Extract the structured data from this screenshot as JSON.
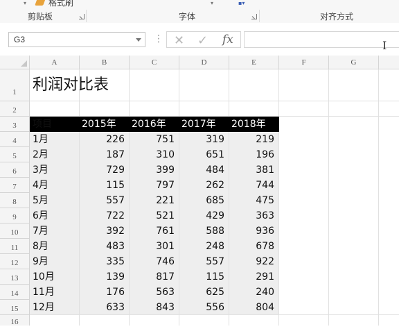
{
  "ribbon": {
    "format_painter": "格式刷",
    "groups": [
      "剪贴板",
      "字体",
      "对齐方式"
    ]
  },
  "formula_bar": {
    "name_box": "G3",
    "cancel_icon": "✕",
    "enter_icon": "✓",
    "fx_label": "fx",
    "formula": ""
  },
  "columns": [
    "A",
    "B",
    "C",
    "D",
    "E",
    "F",
    "G"
  ],
  "rows": [
    "1",
    "2",
    "3",
    "4",
    "5",
    "6",
    "7",
    "8",
    "9",
    "10",
    "11",
    "12",
    "13",
    "14",
    "15",
    "16"
  ],
  "sheet": {
    "title": "利润对比表",
    "headers": [
      "项目",
      "2015年",
      "2016年",
      "2017年",
      "2018年"
    ],
    "data": [
      [
        "1月",
        "226",
        "751",
        "319",
        "219"
      ],
      [
        "2月",
        "187",
        "310",
        "651",
        "196"
      ],
      [
        "3月",
        "729",
        "399",
        "484",
        "381"
      ],
      [
        "4月",
        "115",
        "797",
        "262",
        "744"
      ],
      [
        "5月",
        "557",
        "221",
        "685",
        "475"
      ],
      [
        "6月",
        "722",
        "521",
        "429",
        "363"
      ],
      [
        "7月",
        "392",
        "761",
        "588",
        "936"
      ],
      [
        "8月",
        "483",
        "301",
        "248",
        "678"
      ],
      [
        "9月",
        "335",
        "746",
        "557",
        "922"
      ],
      [
        "10月",
        "139",
        "817",
        "115",
        "291"
      ],
      [
        "11月",
        "176",
        "563",
        "625",
        "240"
      ],
      [
        "12月",
        "633",
        "843",
        "556",
        "804"
      ]
    ]
  },
  "colors": {
    "header_band": "#000000",
    "header_text": "#ffffff",
    "table_fill": "#eeeeee",
    "accent": "#e8a33c"
  }
}
